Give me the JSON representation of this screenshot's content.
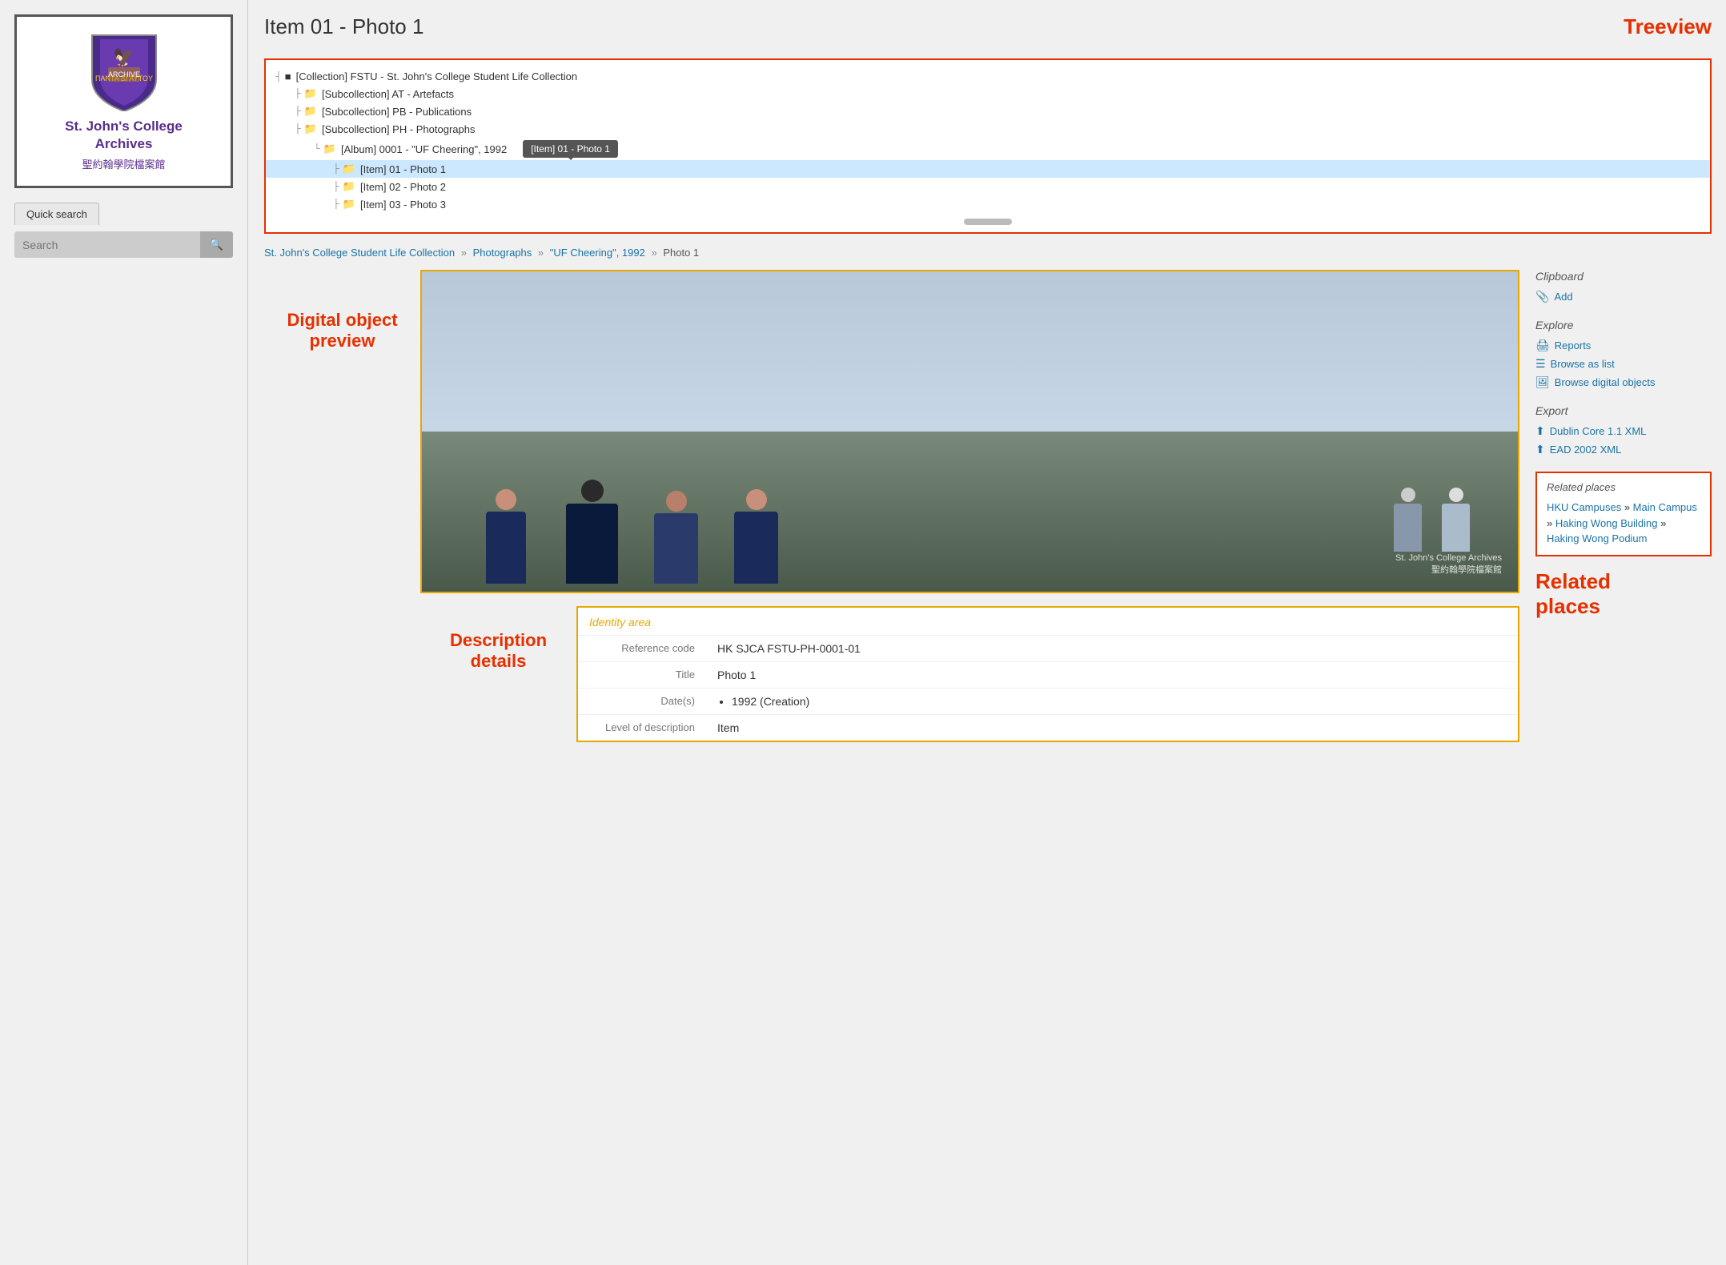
{
  "sidebar": {
    "logo": {
      "title_line1": "St. John's College",
      "title_line2": "Archives",
      "subtitle": "聖約翰學院檔案館"
    },
    "quick_search_label": "Quick search",
    "search_placeholder": "Search"
  },
  "page": {
    "title": "Item 01 - Photo 1",
    "treeview_label": "Treeview"
  },
  "treeview": {
    "items": [
      {
        "indent": 0,
        "icon": "■",
        "connector": "┤",
        "label": "[Collection] FSTU - St. John's College Student Life Collection",
        "selected": false
      },
      {
        "indent": 1,
        "icon": "📁",
        "connector": "├",
        "label": "[Subcollection] AT - Artefacts",
        "selected": false
      },
      {
        "indent": 1,
        "icon": "📁",
        "connector": "├",
        "label": "[Subcollection] PB - Publications",
        "selected": false
      },
      {
        "indent": 1,
        "icon": "📁",
        "connector": "├",
        "label": "[Subcollection] PH - Photographs",
        "selected": false
      },
      {
        "indent": 2,
        "icon": "📁",
        "connector": "└",
        "label": "[Album] 0001 - \"UF Cheering\", 1992",
        "selected": false
      },
      {
        "indent": 3,
        "icon": "📁",
        "connector": "├",
        "label": "[Item] 01 - Photo 1",
        "selected": true
      },
      {
        "indent": 3,
        "icon": "📁",
        "connector": "├",
        "label": "[Item] 02 - Photo 2",
        "selected": false
      },
      {
        "indent": 3,
        "icon": "📁",
        "connector": "├",
        "label": "[Item] 03 - Photo 3",
        "selected": false
      }
    ],
    "tooltip": "[Item] 01 - Photo 1"
  },
  "breadcrumb": {
    "items": [
      {
        "label": "St. John's College Student Life Collection",
        "link": true
      },
      {
        "label": "Photographs",
        "link": true
      },
      {
        "label": "\"UF Cheering\", 1992",
        "link": true
      },
      {
        "label": "Photo 1",
        "link": false
      }
    ]
  },
  "preview": {
    "label_line1": "Digital object",
    "label_line2": "preview"
  },
  "identity": {
    "section_title": "Identity area",
    "fields": [
      {
        "label": "Reference code",
        "value": "HK SJCA FSTU-PH-0001-01"
      },
      {
        "label": "Title",
        "value": "Photo 1"
      },
      {
        "label": "Date(s)",
        "value": "1992 (Creation)",
        "bullet": true
      },
      {
        "label": "Level of description",
        "value": "Item"
      }
    ]
  },
  "right_panel": {
    "clipboard": {
      "heading": "Clipboard",
      "add_label": "Add"
    },
    "explore": {
      "heading": "Explore",
      "links": [
        {
          "icon": "🖨",
          "label": "Reports"
        },
        {
          "icon": "☰",
          "label": "Browse as list"
        },
        {
          "icon": "🖼",
          "label": "Browse digital objects"
        }
      ]
    },
    "export": {
      "heading": "Export",
      "links": [
        {
          "icon": "⬆",
          "label": "Dublin Core 1.1 XML"
        },
        {
          "icon": "⬆",
          "label": "EAD 2002 XML"
        }
      ]
    },
    "related_places": {
      "heading": "Related places",
      "links_text": "HKU Campuses » Main Campus » Haking Wong Building » Haking Wong Podium"
    },
    "related_label_line1": "Related",
    "related_label_line2": "places"
  },
  "desc_label": {
    "line1": "Description",
    "line2": "details"
  },
  "watermark": {
    "line1": "St. John's College Archives",
    "line2": "聖約翰學院檔案館"
  }
}
